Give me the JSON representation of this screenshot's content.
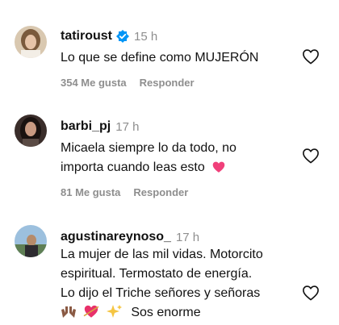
{
  "comments": [
    {
      "username": "tatiroust",
      "verified": true,
      "time": "15 h",
      "text_lines": [
        "Lo que se define como MUJERÓN"
      ],
      "likes": "354 Me gusta",
      "reply": "Responder"
    },
    {
      "username": "barbi_pj",
      "verified": false,
      "time": "17 h",
      "text_lines": [
        "Micaela siempre lo da todo, no",
        "importa cuando leas esto"
      ],
      "likes": "81 Me gusta",
      "reply": "Responder"
    },
    {
      "username": "agustinareynoso_",
      "verified": false,
      "time": "17 h",
      "text_lines": [
        "La mujer de las mil vidas. Motorcito",
        "espiritual. Termostato de energía.",
        "Lo dijo el Triche señores y señoras"
      ],
      "emoji_line_text": "Sos enorme"
    }
  ],
  "icons": {
    "like": "heart-outline-icon",
    "verified": "verified-badge-icon",
    "emoji_heart": "pink-heart-emoji",
    "emoji_hands": "raised-hands-emoji",
    "emoji_arrow_heart": "heart-with-arrow-emoji",
    "emoji_sparkles": "sparkles-emoji"
  },
  "colors": {
    "text": "#111111",
    "muted": "#8e8e8e",
    "verified": "#0095f6",
    "heart_emoji": "#f0407a"
  }
}
